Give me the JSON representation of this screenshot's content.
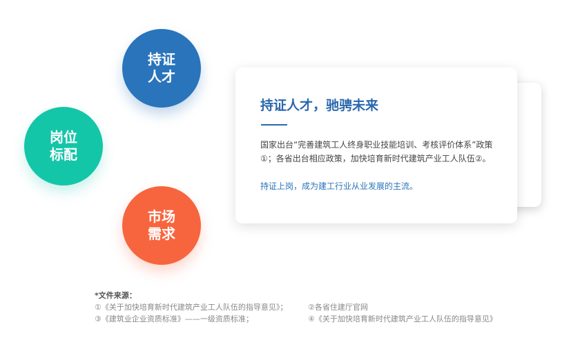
{
  "circles": {
    "certified": {
      "line1": "持证",
      "line2": "人才",
      "color": "#2a74bb"
    },
    "job_matching": {
      "line1": "岗位",
      "line2": "标配",
      "color": "#14c6a8"
    },
    "market_demand": {
      "line1": "市场",
      "line2": "需求",
      "color": "#f7653e"
    }
  },
  "card": {
    "title": "持证人才，驰骋未来",
    "body": "国家出台“完善建筑工人终身职业技能培训、考核评价体系”政策①；各省出台相应政策，加快培育新时代建筑产业工人队伍②。",
    "highlight": "持证上岗，成为建工行业从业发展的主流。",
    "accent_color": "#2a68ad"
  },
  "sources": {
    "title": "*文件来源：",
    "items": [
      "①《关于加快培育新时代建筑产业工人队伍的指导意见》；",
      "②各省住建厅官网",
      "③《建筑业企业资质标准》——一级资质标准；",
      "④《关于加快培育新时代建筑产业工人队伍的指导意见》"
    ]
  }
}
